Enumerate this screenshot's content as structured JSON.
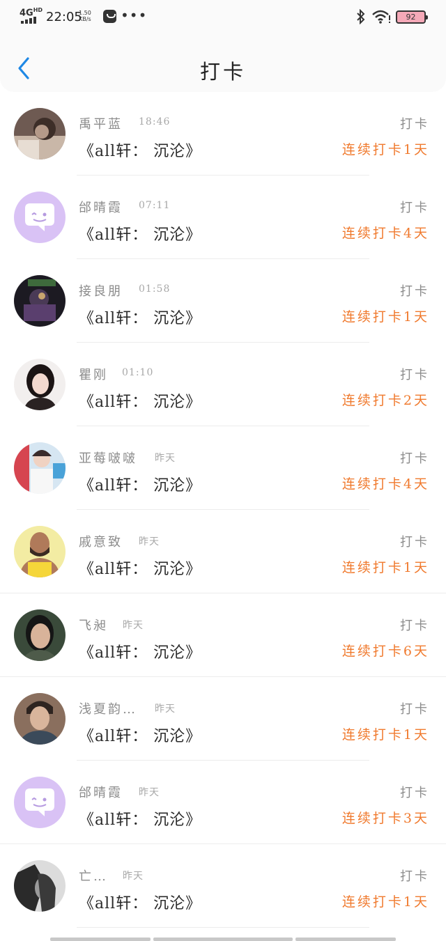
{
  "status_bar": {
    "network": "4G",
    "network_sup": "HD",
    "time": "22:05",
    "speed_value": "1.50",
    "speed_unit": "KB/s",
    "battery": "92",
    "icons": [
      "signal-icon",
      "app-bag-icon",
      "more-dots-icon",
      "bluetooth-icon",
      "wifi-icon",
      "battery-icon"
    ]
  },
  "header": {
    "title": "打卡",
    "back_icon": "chevron-left-icon",
    "accent_color": "#1e88e5"
  },
  "colors": {
    "streak": "#f07a2e",
    "muted": "#8c8c8c",
    "default_avatar_bg": "#d9c2f5"
  },
  "checkins": [
    {
      "name": "禹平蓝",
      "time": "18:46",
      "work": "《all轩：  沉沦》",
      "action": "打卡",
      "streak": "连续打卡1天",
      "avatar": "photo"
    },
    {
      "name": "邰晴霞",
      "time": "07:11",
      "work": "《all轩：  沉沦》",
      "action": "打卡",
      "streak": "连续打卡4天",
      "avatar": "default-chat-icon"
    },
    {
      "name": "接良朋",
      "time": "01:58",
      "work": "《all轩：  沉沦》",
      "action": "打卡",
      "streak": "连续打卡1天",
      "avatar": "photo"
    },
    {
      "name": "瞿刚",
      "time": "01:10",
      "work": "《all轩：  沉沦》",
      "action": "打卡",
      "streak": "连续打卡2天",
      "avatar": "photo"
    },
    {
      "name": "亚莓啵啵",
      "time": "昨天",
      "work": "《all轩：  沉沦》",
      "action": "打卡",
      "streak": "连续打卡4天",
      "avatar": "photo"
    },
    {
      "name": "戚意致",
      "time": "昨天",
      "work": "《all轩：  沉沦》",
      "action": "打卡",
      "streak": "连续打卡1天",
      "avatar": "photo"
    },
    {
      "name": "飞昶",
      "time": "昨天",
      "work": "《all轩：  沉沦》",
      "action": "打卡",
      "streak": "连续打卡6天",
      "avatar": "photo"
    },
    {
      "name": "浅夏韵…",
      "time": "昨天",
      "work": "《all轩：  沉沦》",
      "action": "打卡",
      "streak": "连续打卡1天",
      "avatar": "photo"
    },
    {
      "name": "邰晴霞",
      "time": "昨天",
      "work": "《all轩：  沉沦》",
      "action": "打卡",
      "streak": "连续打卡3天",
      "avatar": "default-chat-icon"
    },
    {
      "name": "亡…",
      "time": "昨天",
      "work": "《all轩：  沉沦》",
      "action": "打卡",
      "streak": "连续打卡1天",
      "avatar": "photo"
    }
  ]
}
